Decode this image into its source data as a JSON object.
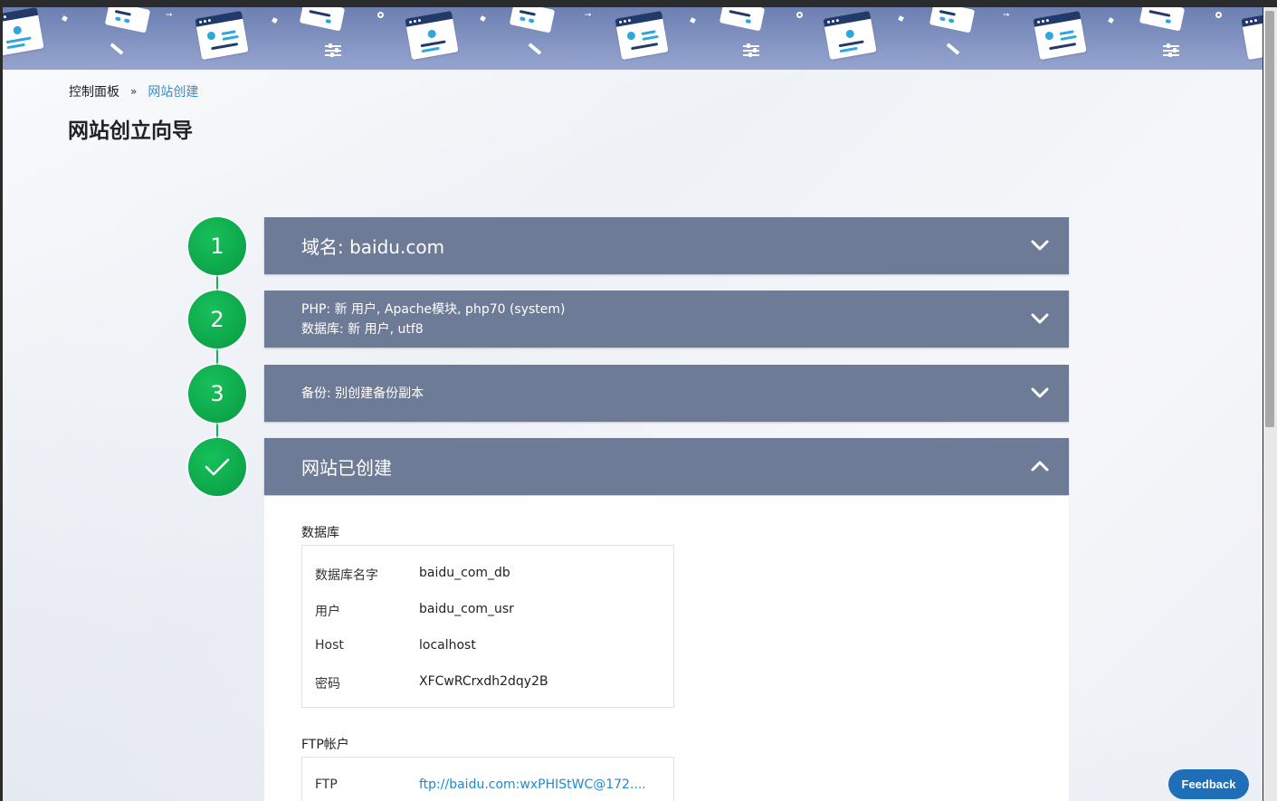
{
  "breadcrumb": {
    "home": "控制面板",
    "separator": "»",
    "current": "网站创建"
  },
  "page_title": "网站创立向导",
  "steps": [
    {
      "number": "1",
      "title": "域名: baidu.com",
      "state": "collapsed"
    },
    {
      "number": "2",
      "line1": "PHP: 新 用户, Apache模块, php70 (system)",
      "line2": "数据库: 新 用户, utf8",
      "state": "collapsed"
    },
    {
      "number": "3",
      "title": "备份: 别创建备份副本",
      "state": "collapsed"
    },
    {
      "icon": "checkmark-icon",
      "title": "网站已创建",
      "state": "expanded"
    }
  ],
  "database": {
    "label": "数据库",
    "rows": [
      {
        "key": "数据库名字",
        "value": "baidu_com_db"
      },
      {
        "key": "用户",
        "value": "baidu_com_usr"
      },
      {
        "key": "Host",
        "value": "localhost"
      },
      {
        "key": "密码",
        "value": "XFCwRCrxdh2dqy2B"
      }
    ]
  },
  "ftp": {
    "label": "FTP帐户",
    "rows": [
      {
        "key": "FTP",
        "value": "ftp://baidu.com:wxPHIStWC@172...."
      }
    ]
  },
  "feedback_label": "Feedback",
  "colors": {
    "accent_green": "#0ea94c",
    "panel": "#6e7b96",
    "link": "#1f8ad2",
    "feedback": "#1f6fb8"
  }
}
